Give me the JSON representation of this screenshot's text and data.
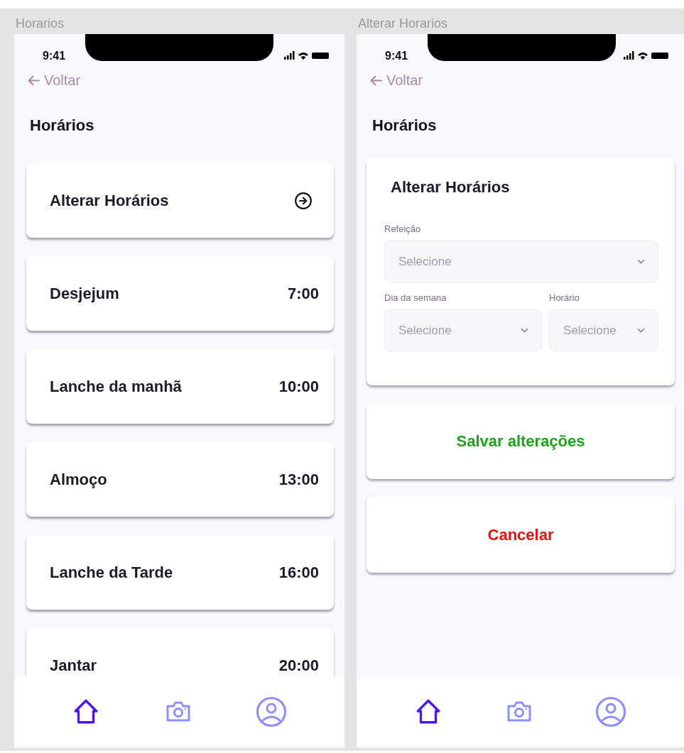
{
  "screens": [
    {
      "kind": "list",
      "frame_label": "Horarios",
      "status_time": "9:41",
      "back": "Voltar",
      "title": "Horários",
      "items": [
        {
          "kind": "link",
          "label": "Alterar Horários"
        },
        {
          "kind": "time",
          "label": "Desjejum",
          "time": "7:00"
        },
        {
          "kind": "time",
          "label": "Lanche da manhã",
          "time": "10:00"
        },
        {
          "kind": "time",
          "label": "Almoço",
          "time": "13:00"
        },
        {
          "kind": "time",
          "label": "Lanche da Tarde",
          "time": "16:00"
        },
        {
          "kind": "time",
          "label": "Jantar",
          "time": "20:00"
        }
      ],
      "nav": [
        {
          "kind": "home",
          "selected": true
        },
        {
          "kind": "camera",
          "selected": false
        },
        {
          "kind": "profile",
          "selected": false
        }
      ]
    },
    {
      "kind": "form",
      "frame_label": "Alterar Horarios",
      "status_time": "9:41",
      "back": "Voltar",
      "title": "Horários",
      "form": {
        "title": "Alterar Horários",
        "fields": [
          {
            "label": "Refeição",
            "placeholder": "Selecione"
          },
          {
            "label": "Dia da semana",
            "placeholder": "Selecione"
          },
          {
            "label": "Horário",
            "placeholder": "Selecione"
          }
        ]
      },
      "buttons": [
        {
          "kind": "save",
          "label": "Salvar alterações"
        },
        {
          "kind": "cancel",
          "label": "Cancelar"
        }
      ],
      "nav": [
        {
          "kind": "home",
          "selected": true
        },
        {
          "kind": "camera",
          "selected": false
        },
        {
          "kind": "profile",
          "selected": false
        }
      ]
    }
  ]
}
